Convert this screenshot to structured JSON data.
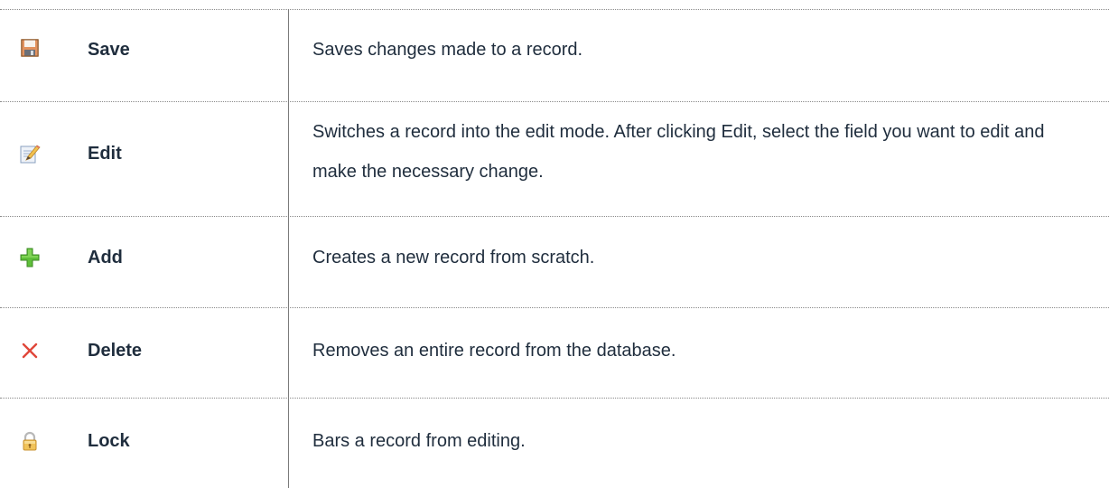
{
  "rows": [
    {
      "icon": "save-icon",
      "name": "Save",
      "description": "Saves changes made to a record."
    },
    {
      "icon": "edit-icon",
      "name": "Edit",
      "description": "Switches a record into the edit mode. After clicking Edit, select the field you want to edit and make the necessary change."
    },
    {
      "icon": "add-icon",
      "name": "Add",
      "description": "Creates a new record from scratch."
    },
    {
      "icon": "delete-icon",
      "name": "Delete",
      "description": "Removes an entire record from the database."
    },
    {
      "icon": "lock-icon",
      "name": "Lock",
      "description": "Bars a record from editing."
    }
  ]
}
